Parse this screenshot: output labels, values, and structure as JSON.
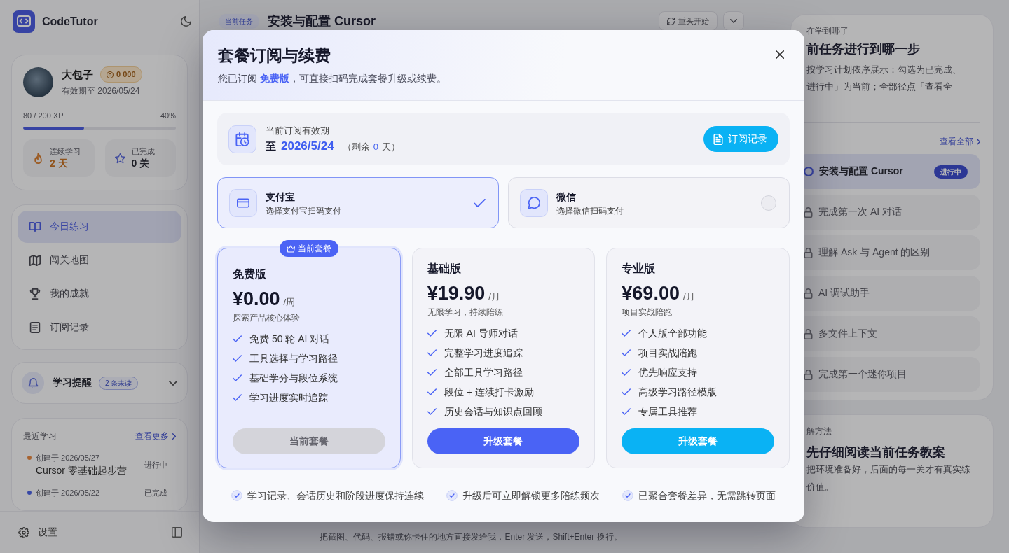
{
  "sidebar": {
    "brand": "CodeTutor",
    "profile": {
      "name": "大包子",
      "badge": "0 000",
      "expiry": "有效期至 2026/05/24",
      "xp": "80 / 200 XP",
      "xp_percent": "40%",
      "level": 0.4,
      "stats": [
        {
          "kind": "streak",
          "label": "连续学习",
          "value": "2 天"
        },
        {
          "kind": "completed",
          "label": "已完成",
          "value": "0 关"
        }
      ]
    },
    "nav": [
      {
        "label": "今日练习",
        "selected": true
      },
      {
        "label": "闯关地图",
        "selected": false
      },
      {
        "label": "我的成就",
        "selected": false
      },
      {
        "label": "订阅记录",
        "selected": false
      }
    ],
    "reminder": {
      "label": "学习提醒",
      "badge": "2 条未读",
      "expanded": false
    },
    "recent": {
      "title": "最近学习",
      "more": "查看更多",
      "items": [
        {
          "kind": "in_progress",
          "date": "创建于 2026/05/27",
          "title": "Cursor 零基础起步营",
          "status": "进行中"
        },
        {
          "kind": "done",
          "date": "创建于 2026/05/22",
          "status": "已完成"
        }
      ]
    },
    "settings": "设置"
  },
  "task_header": {
    "tag": "当前任务",
    "title": "安装与配置 Cursor",
    "restart": "重头开始"
  },
  "composer_hint": "把截图、代码、报错或你卡住的地方直接发给我，Enter 发送，Shift+Enter 换行。",
  "progress_panel": {
    "label": "在学到哪了",
    "title": "前任务进行到哪一步",
    "description_lines": [
      "按学习计划依序展示：勾选为已完成、",
      "进行中」为当前；全部径点「查看全"
    ],
    "view_all": "查看全部",
    "tasks": [
      {
        "kind": "current",
        "title": "安装与配置 Cursor",
        "badge": "进行中",
        "selected": true
      },
      {
        "kind": "locked",
        "title": "完成第一次 AI 对话",
        "selected": false
      },
      {
        "kind": "locked",
        "title": "理解 Ask 与 Agent 的区别",
        "selected": false
      },
      {
        "kind": "locked",
        "title": "AI 调试助手",
        "selected": false
      },
      {
        "kind": "locked",
        "title": "多文件上下文",
        "selected": false
      },
      {
        "kind": "locked",
        "title": "完成第一个迷你项目",
        "selected": false
      }
    ]
  },
  "method_panel": {
    "label": "解方法",
    "title": "先仔细阅读当前任务教案",
    "description_lines": [
      "把环境准备好，后面的每一关才有真实练",
      "价值。"
    ]
  },
  "dialog": {
    "title": "套餐订阅与续费",
    "subtitle": "您已订阅 **免费版**，可直接扫码完成套餐升级或续费。",
    "validity": {
      "label": "当前订阅有效期",
      "prefix": "至",
      "date": "2026/5/24",
      "remaining_label": "（剩余",
      "remaining_days": "0",
      "remaining_unit": "天）",
      "records_button": "订阅记录"
    },
    "payment_methods": [
      {
        "name": "支付宝",
        "hint": "选择支付宝扫码支付",
        "selected": true
      },
      {
        "name": "微信",
        "hint": "选择微信扫码支付",
        "selected": false
      }
    ],
    "plans": [
      {
        "name": "免费版",
        "price": "¥0.00",
        "period": "/周",
        "tagline": "探索产品核心体验",
        "current": true,
        "badge": "当前套餐",
        "features": [
          "免费 50 轮 AI 对话",
          "工具选择与学习路径",
          "基础学分与段位系统",
          "学习进度实时追踪"
        ],
        "button": {
          "label": "当前套餐",
          "disabled": true
        }
      },
      {
        "name": "基础版",
        "price": "¥19.90",
        "period": "/月",
        "tagline": "无限学习，持续陪练",
        "current": false,
        "features": [
          "无限 AI 导师对话",
          "完整学习进度追踪",
          "全部工具学习路径",
          "段位 + 连续打卡激励",
          "历史会话与知识点回顾"
        ],
        "button": {
          "label": "升级套餐",
          "disabled": false,
          "color": "#4a63f5"
        }
      },
      {
        "name": "专业版",
        "price": "¥69.00",
        "period": "/月",
        "tagline": "项目实战陪跑",
        "current": false,
        "features": [
          "个人版全部功能",
          "项目实战陪跑",
          "优先响应支持",
          "高级学习路径模版",
          "专属工具推荐"
        ],
        "button": {
          "label": "升级套餐",
          "disabled": false,
          "color": "#0ab2f4"
        }
      }
    ],
    "notes": [
      "学习记录、会话历史和阶段进度保持连续",
      "升级后可立即解锁更多陪练频次",
      "已聚合套餐差异，无需跳转页面"
    ]
  }
}
